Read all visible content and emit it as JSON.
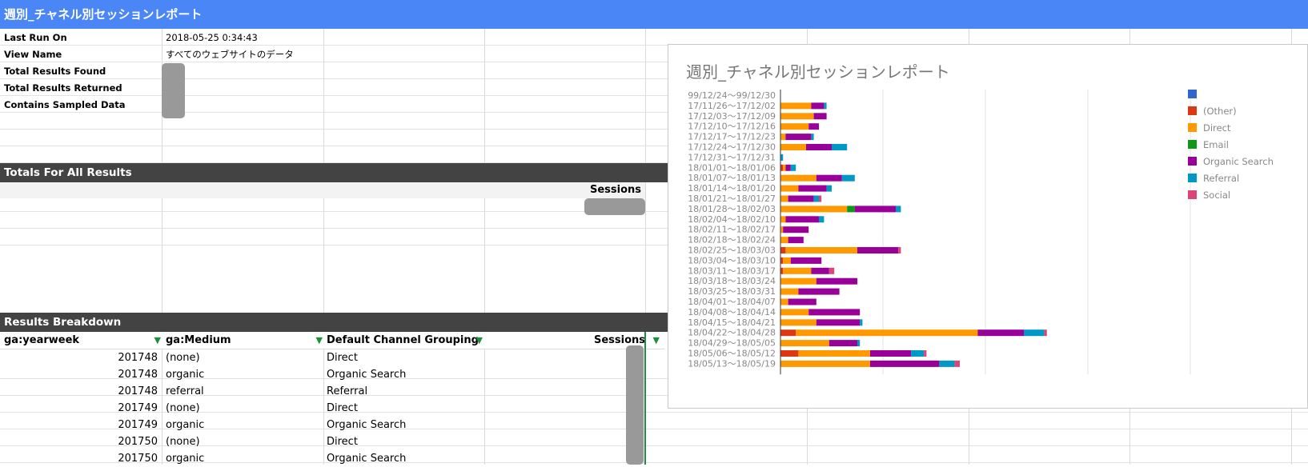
{
  "header": {
    "title": "週別_チャネル別セッションレポート"
  },
  "meta": [
    {
      "label": "Last Run On",
      "value": "2018-05-25 0:34:43"
    },
    {
      "label": "View Name",
      "value": "すべてのウェブサイトのデータ"
    },
    {
      "label": "Total Results Found",
      "value": ""
    },
    {
      "label": "Total Results Returned",
      "value": ""
    },
    {
      "label": "Contains Sampled Data",
      "value": ""
    }
  ],
  "totals": {
    "title": "Totals For All Results",
    "sessions_label": "Sessions"
  },
  "breakdown": {
    "title": "Results Breakdown",
    "columns": [
      "ga:yearweek",
      "ga:Medium",
      "Default Channel Grouping",
      "Sessions"
    ],
    "rows": [
      [
        "201748",
        "(none)",
        "Direct"
      ],
      [
        "201748",
        "organic",
        "Organic Search"
      ],
      [
        "201748",
        "referral",
        "Referral"
      ],
      [
        "201749",
        "(none)",
        "Direct"
      ],
      [
        "201749",
        "organic",
        "Organic Search"
      ],
      [
        "201750",
        "(none)",
        "Direct"
      ],
      [
        "201750",
        "organic",
        "Organic Search"
      ]
    ]
  },
  "chart_data": {
    "type": "bar",
    "orientation": "horizontal",
    "stacked": true,
    "title": "週別_チャネル別セッションレポート",
    "categories": [
      "99/12/24〜99/12/30",
      "17/11/26〜17/12/02",
      "17/12/03〜17/12/09",
      "17/12/10〜17/12/16",
      "17/12/17〜17/12/23",
      "17/12/24〜17/12/30",
      "17/12/31〜17/12/31",
      "18/01/01〜18/01/06",
      "18/01/07〜18/01/13",
      "18/01/14〜18/01/20",
      "18/01/21〜18/01/27",
      "18/01/28〜18/02/03",
      "18/02/04〜18/02/10",
      "18/02/11〜18/02/17",
      "18/02/18〜18/02/24",
      "18/02/25〜18/03/03",
      "18/03/04〜18/03/10",
      "18/03/11〜18/03/17",
      "18/03/18〜18/03/24",
      "18/03/25〜18/03/31",
      "18/04/01〜18/04/07",
      "18/04/08〜18/04/14",
      "18/04/15〜18/04/21",
      "18/04/22〜18/04/28",
      "18/04/29〜18/05/05",
      "18/05/06〜18/05/12",
      "18/05/13〜18/05/19"
    ],
    "series": [
      {
        "name": "",
        "color": "#3366cc",
        "values": [
          0,
          0,
          0,
          0,
          0,
          0,
          0,
          0,
          0,
          0,
          0,
          0,
          0,
          0,
          0,
          0,
          0,
          0,
          0,
          0,
          0,
          0,
          0,
          0,
          0,
          0,
          0
        ]
      },
      {
        "name": "(Other)",
        "color": "#dc3912",
        "values": [
          0,
          0,
          0,
          0,
          0,
          0,
          0,
          1,
          0,
          0,
          0,
          0,
          0,
          0,
          0,
          2,
          1,
          1,
          0,
          0,
          0,
          0,
          0,
          6,
          0,
          7,
          0
        ]
      },
      {
        "name": "Direct",
        "color": "#ff9900",
        "values": [
          0,
          12,
          13,
          11,
          2,
          10,
          0,
          1,
          14,
          7,
          3,
          26,
          2,
          1,
          3,
          28,
          3,
          11,
          14,
          7,
          3,
          11,
          14,
          71,
          19,
          28,
          35
        ]
      },
      {
        "name": "Email",
        "color": "#109618",
        "values": [
          0,
          0,
          0,
          0,
          0,
          0,
          0,
          0,
          0,
          0,
          0,
          3,
          0,
          0,
          0,
          0,
          0,
          0,
          0,
          0,
          0,
          0,
          0,
          0,
          0,
          0,
          0
        ]
      },
      {
        "name": "Organic Search",
        "color": "#990099",
        "values": [
          0,
          5,
          5,
          4,
          10,
          10,
          0,
          2,
          10,
          11,
          10,
          16,
          13,
          10,
          6,
          16,
          12,
          7,
          16,
          16,
          11,
          20,
          17,
          18,
          11,
          16,
          27
        ]
      },
      {
        "name": "Referral",
        "color": "#0099c6",
        "values": [
          0,
          1,
          0,
          0,
          1,
          6,
          1,
          2,
          5,
          2,
          2,
          2,
          2,
          0,
          0,
          0,
          0,
          0,
          0,
          0,
          0,
          0,
          1,
          8,
          1,
          5,
          6
        ]
      },
      {
        "name": "Social",
        "color": "#dd4477",
        "values": [
          0,
          0,
          0,
          0,
          0,
          0,
          0,
          0,
          0,
          0,
          1,
          0,
          0,
          0,
          0,
          1,
          0,
          2,
          0,
          0,
          0,
          0,
          0,
          1,
          0,
          1,
          2
        ]
      }
    ],
    "xlim": [
      0,
      160
    ],
    "grid": true,
    "legend": "right"
  }
}
